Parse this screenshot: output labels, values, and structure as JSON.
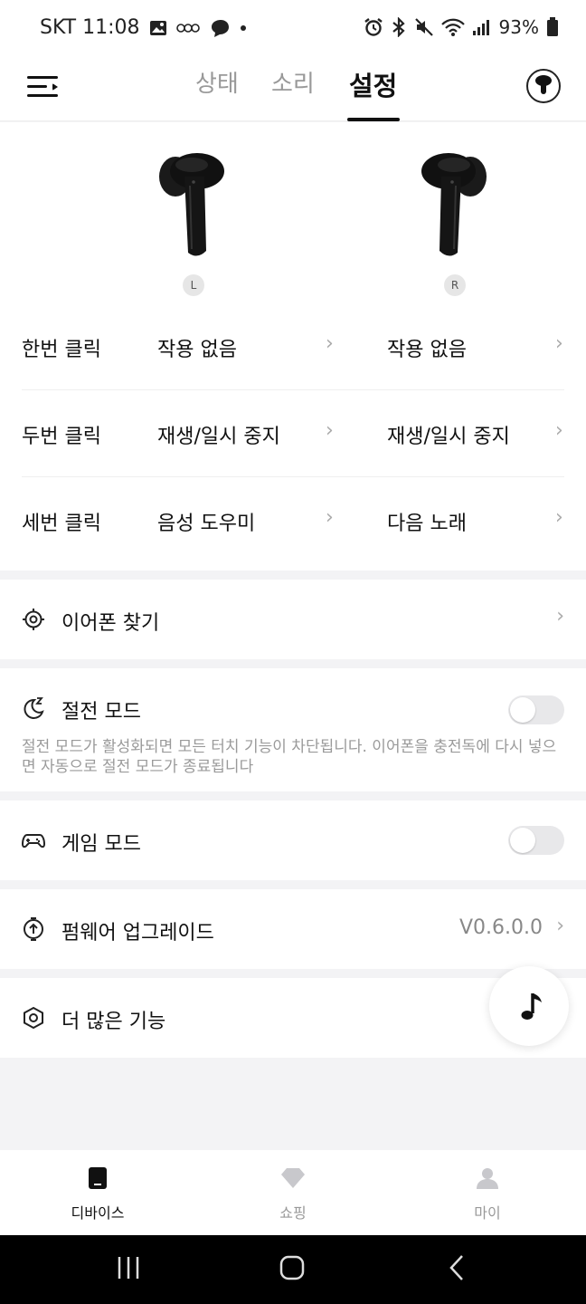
{
  "status_bar": {
    "carrier_time": "SKT 11:08",
    "battery": "93%"
  },
  "header": {
    "tabs": [
      {
        "label": "상태"
      },
      {
        "label": "소리"
      },
      {
        "label": "설정"
      }
    ]
  },
  "earbuds": {
    "left_label": "L",
    "right_label": "R"
  },
  "controls": [
    {
      "name": "한번 클릭",
      "left": "작용 없음",
      "right": "작용 없음"
    },
    {
      "name": "두번 클릭",
      "left": "재생/일시 중지",
      "right": "재생/일시 중지"
    },
    {
      "name": "세번 클릭",
      "left": "음성 도우미",
      "right": "다음 노래"
    }
  ],
  "settings": {
    "find_earphones": "이어폰 찾기",
    "power_saving": {
      "label": "절전 모드",
      "enabled": false,
      "description": "절전 모드가 활성화되면 모든 터치 기능이 차단됩니다. 이어폰을 충전독에 다시 넣으면 자동으로 절전 모드가 종료됩니다"
    },
    "game_mode": {
      "label": "게임 모드",
      "enabled": false
    },
    "firmware": {
      "label": "펌웨어 업그레이드",
      "version": "V0.6.0.0"
    },
    "more_features": "더 많은 기능"
  },
  "bottom_nav": {
    "items": [
      {
        "label": "디바이스"
      },
      {
        "label": "쇼핑"
      },
      {
        "label": "마이"
      }
    ]
  }
}
